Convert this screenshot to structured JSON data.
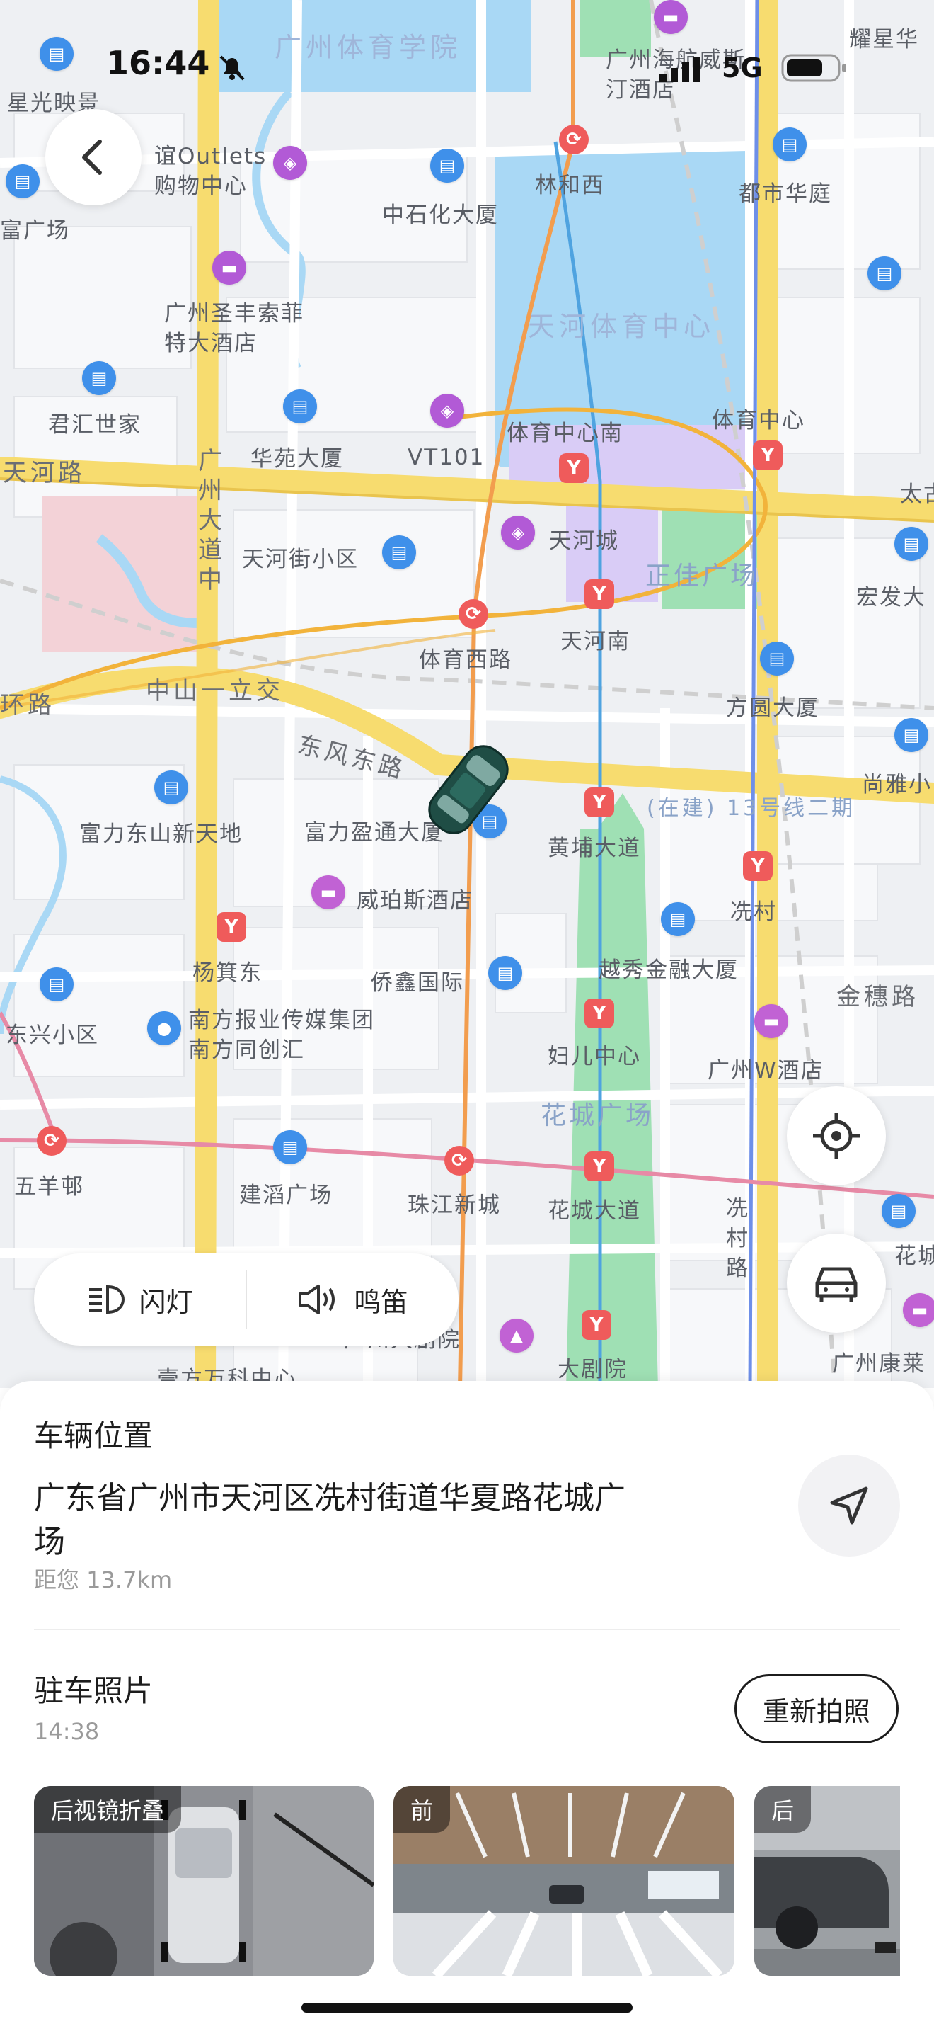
{
  "status_bar": {
    "time": "16:44",
    "network": "5G"
  },
  "map": {
    "labels": [
      {
        "text": "广州体育学院",
        "cls": "big"
      },
      {
        "text": "广州海航威斯汀酒店",
        "cls": ""
      },
      {
        "text": "耀星华",
        "cls": ""
      },
      {
        "text": "星光映景",
        "cls": ""
      },
      {
        "text": "谊Outlets购物中心",
        "cls": ""
      },
      {
        "text": "林和西",
        "cls": ""
      },
      {
        "text": "都市华庭",
        "cls": ""
      },
      {
        "text": "中石化大厦",
        "cls": ""
      },
      {
        "text": "富广场",
        "cls": ""
      },
      {
        "text": "广州圣丰索菲特大酒店",
        "cls": ""
      },
      {
        "text": "天河体育中心",
        "cls": "big"
      },
      {
        "text": "君汇世家",
        "cls": ""
      },
      {
        "text": "体育中心南",
        "cls": ""
      },
      {
        "text": "体育中心",
        "cls": ""
      },
      {
        "text": "华苑大厦",
        "cls": ""
      },
      {
        "text": "VT101",
        "cls": ""
      },
      {
        "text": "天河路",
        "cls": "road"
      },
      {
        "text": "太古",
        "cls": ""
      },
      {
        "text": "广州大道中",
        "cls": "road"
      },
      {
        "text": "天河城",
        "cls": ""
      },
      {
        "text": "正佳广场",
        "cls": "park"
      },
      {
        "text": "天河街小区",
        "cls": ""
      },
      {
        "text": "宏发大",
        "cls": ""
      },
      {
        "text": "天河南",
        "cls": ""
      },
      {
        "text": "体育西路",
        "cls": ""
      },
      {
        "text": "环路",
        "cls": "road"
      },
      {
        "text": "中山一立交",
        "cls": "road"
      },
      {
        "text": "方圆大厦",
        "cls": ""
      },
      {
        "text": "东风东路",
        "cls": "road"
      },
      {
        "text": "尚雅小",
        "cls": ""
      },
      {
        "text": "(在建) 13号线二期",
        "cls": "park"
      },
      {
        "text": "富力东山新天地",
        "cls": ""
      },
      {
        "text": "富力盈通大厦",
        "cls": ""
      },
      {
        "text": "黄埔大道",
        "cls": ""
      },
      {
        "text": "威珀斯酒店",
        "cls": ""
      },
      {
        "text": "冼村",
        "cls": ""
      },
      {
        "text": "杨箕东",
        "cls": ""
      },
      {
        "text": "侨鑫国际",
        "cls": ""
      },
      {
        "text": "越秀金融大厦",
        "cls": ""
      },
      {
        "text": "金穗路",
        "cls": "road"
      },
      {
        "text": "东兴小区",
        "cls": ""
      },
      {
        "text": "南方报业传媒集团南方同创汇",
        "cls": ""
      },
      {
        "text": "妇儿中心",
        "cls": ""
      },
      {
        "text": "广州W酒店",
        "cls": ""
      },
      {
        "text": "花城广场",
        "cls": "park"
      },
      {
        "text": "五羊邨",
        "cls": ""
      },
      {
        "text": "建滔广场",
        "cls": ""
      },
      {
        "text": "珠江新城",
        "cls": ""
      },
      {
        "text": "花城大道",
        "cls": ""
      },
      {
        "text": "冼村路",
        "cls": ""
      },
      {
        "text": "花城",
        "cls": ""
      },
      {
        "text": "广州大剧院",
        "cls": ""
      },
      {
        "text": "大剧院",
        "cls": ""
      },
      {
        "text": "广州康莱",
        "cls": ""
      },
      {
        "text": "壹方万科中心",
        "cls": ""
      }
    ]
  },
  "controls": {
    "flash_label": "闪灯",
    "horn_label": "鸣笛"
  },
  "sheet": {
    "location_title": "车辆位置",
    "address": "广东省广州市天河区冼村街道华夏路花城广场",
    "distance": "距您 13.7km",
    "photos_title": "驻车照片",
    "photos_time": "14:38",
    "retake_label": "重新拍照",
    "photos": [
      {
        "tag": "后视镜折叠"
      },
      {
        "tag": "前"
      },
      {
        "tag": "后"
      }
    ]
  },
  "colors": {
    "map_bg": "#eef0f3",
    "road_main": "#f7dc6f",
    "water": "#a9d8f5",
    "park": "#9fe0b4",
    "metro": "#ef5b5b",
    "car": "#1f4d45"
  }
}
